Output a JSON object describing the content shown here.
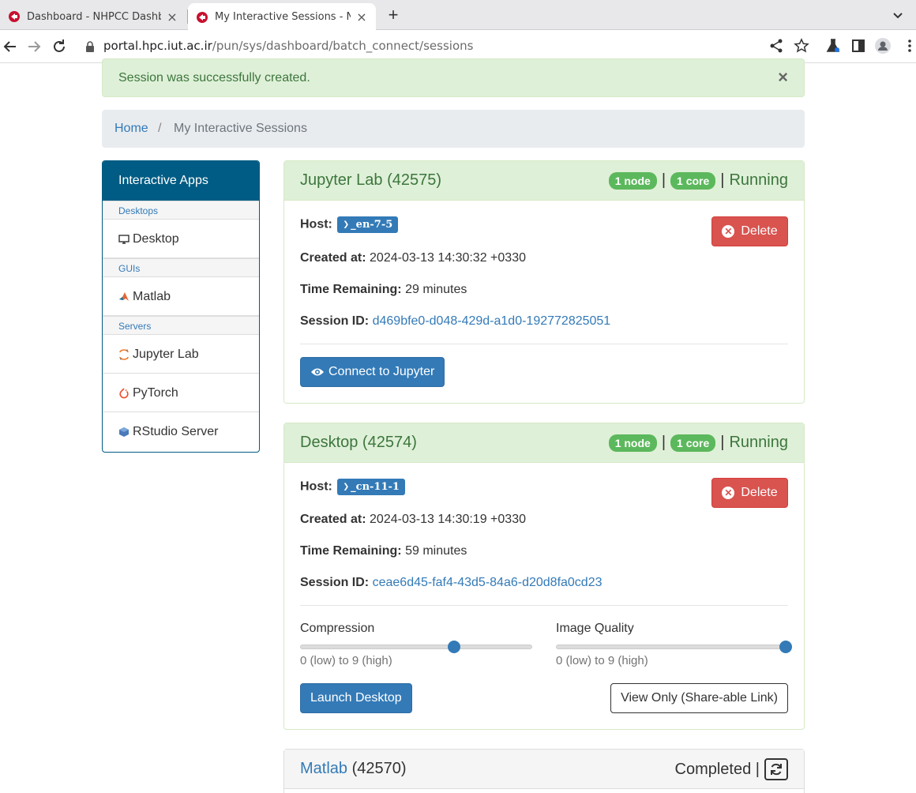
{
  "browser": {
    "tabs": [
      {
        "title": "Dashboard - NHPCC Dashboard",
        "active": false
      },
      {
        "title": "My Interactive Sessions - NHPCC Dashboard",
        "active": true
      }
    ],
    "url_host": "portal.hpc.iut.ac.ir",
    "url_path": "/pun/sys/dashboard/batch_connect/sessions"
  },
  "alert": {
    "message": "Session was successfully created.",
    "close": "×"
  },
  "breadcrumb": {
    "home": "Home",
    "separator": "/",
    "current": "My Interactive Sessions"
  },
  "sidebar": {
    "title": "Interactive Apps",
    "categories": [
      {
        "name": "Desktops",
        "items": [
          {
            "label": "Desktop",
            "icon": "monitor-icon"
          }
        ]
      },
      {
        "name": "GUIs",
        "items": [
          {
            "label": "Matlab",
            "icon": "matlab-icon"
          }
        ]
      },
      {
        "name": "Servers",
        "items": [
          {
            "label": "Jupyter Lab",
            "icon": "jupyter-icon"
          },
          {
            "label": "PyTorch",
            "icon": "pytorch-icon"
          },
          {
            "label": "RStudio Server",
            "icon": "rstudio-icon"
          }
        ]
      }
    ]
  },
  "sessions": [
    {
      "title": "Jupyter Lab (42575)",
      "nodes": "1 node",
      "cores": "1 core",
      "status": "Running",
      "host_label": "Host:",
      "host": "_en-7-5",
      "created_label": "Created at:",
      "created": "2024-03-13 14:30:32 +0330",
      "remaining_label": "Time Remaining:",
      "remaining": "29 minutes",
      "session_label": "Session ID:",
      "session_id": "d469bfe0-d048-429d-a1d0-192772825051",
      "delete": "Delete",
      "connect": "Connect to Jupyter"
    },
    {
      "title": "Desktop (42574)",
      "nodes": "1 node",
      "cores": "1 core",
      "status": "Running",
      "host_label": "Host:",
      "host": "_cn-11-1",
      "created_label": "Created at:",
      "created": "2024-03-13 14:30:19 +0330",
      "remaining_label": "Time Remaining:",
      "remaining": "59 minutes",
      "session_label": "Session ID:",
      "session_id": "ceae6d45-faf4-43d5-84a6-d20d8fa0cd23",
      "delete": "Delete",
      "compression": {
        "label": "Compression",
        "hint": "0 (low) to 9 (high)",
        "value": 6,
        "min": 0,
        "max": 9
      },
      "image_quality": {
        "label": "Image Quality",
        "hint": "0 (low) to 9 (high)",
        "value": 9,
        "min": 0,
        "max": 9
      },
      "launch": "Launch Desktop",
      "view_only": "View Only (Share-able Link)"
    },
    {
      "title_link": "Matlab",
      "title_id": "(42570)",
      "status": "Completed |"
    }
  ],
  "colors": {
    "primary": "#337ab7",
    "success": "#5cb85c",
    "danger": "#d9534f",
    "sidebar": "#005c84"
  }
}
